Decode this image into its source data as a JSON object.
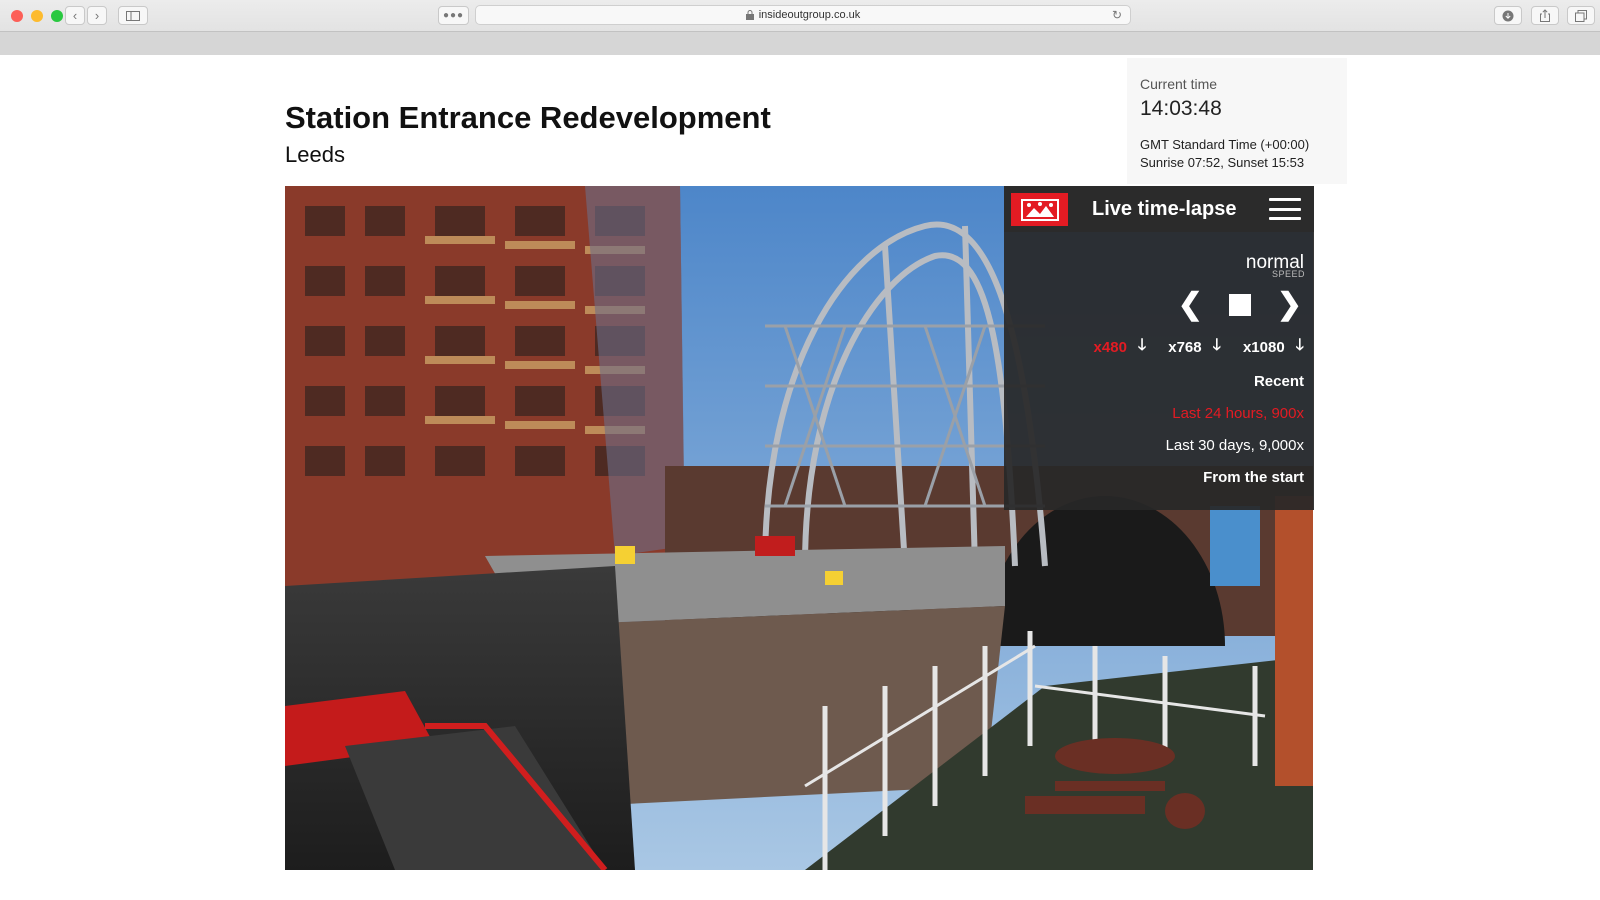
{
  "browser": {
    "url": "insideoutgroup.co.uk",
    "reader_icon": "dots-icon",
    "back_icon": "chevron-left-icon",
    "forward_icon": "chevron-right-icon"
  },
  "page": {
    "title": "Station Entrance Redevelopment",
    "subtitle": "Leeds"
  },
  "time_panel": {
    "label": "Current time",
    "time": "14:03:48",
    "timezone": "GMT Standard Time (+00:00)",
    "sun": "Sunrise 07:52, Sunset 15:53"
  },
  "timelapse": {
    "title": "Live time-lapse",
    "speed_value": "normal",
    "speed_label": "SPEED",
    "prev_glyph": "❮",
    "next_glyph": "❯",
    "sizes": [
      {
        "label": "x480",
        "active": true
      },
      {
        "label": "x768",
        "active": false
      },
      {
        "label": "x1080",
        "active": false
      }
    ],
    "download_glyph": "🡓",
    "recent_heading": "Recent",
    "periods": [
      {
        "label": "Last 24 hours, 900x",
        "active": true
      },
      {
        "label": "Last 30 days, 9,000x",
        "active": false
      },
      {
        "label": "From the start",
        "active": false
      }
    ]
  },
  "colors": {
    "accent": "#e31b23",
    "panel_bg": "#282828"
  }
}
